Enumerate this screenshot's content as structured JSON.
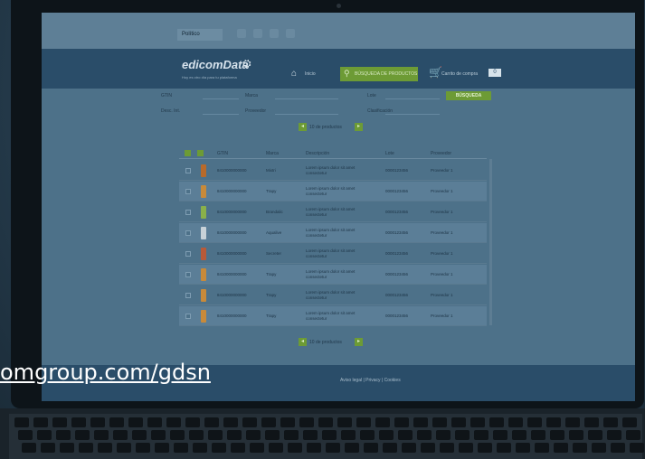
{
  "topbar": {
    "language": "Político"
  },
  "header": {
    "logo_text": "edicomData",
    "tagline": "Hoy es otro día para tu plataforma",
    "home_label": "Inicio",
    "search_tab_label": "BÚSQUEDA DE PRODUCTOS",
    "cart_label": "Carrito de compra",
    "cart_count": "0"
  },
  "filters": {
    "label_1": "GTIN",
    "value_1": "",
    "label_2": "Marca",
    "value_2": "",
    "label_3": "Lote",
    "value_3": "",
    "label_4": "Desc. Int.",
    "value_4": "",
    "label_5": "Proveedor",
    "value_5": "",
    "label_6": "Clasificación",
    "value_6": "",
    "search_button": "BÚSQUEDA"
  },
  "pager": {
    "text": "10   de productos"
  },
  "table": {
    "headers": [
      "GTIN",
      "Marca",
      "Descripción",
      "Lote",
      "Proveedor"
    ],
    "rows": [
      {
        "gtin": "8410000000000",
        "brand": "Mixtri",
        "desc": "Lorem ipsum dolor sit amet consectetur",
        "lot": "0000123456",
        "supplier": "Proveedor 1",
        "color": "#b86a2a"
      },
      {
        "gtin": "8410000000000",
        "brand": "Trapy",
        "desc": "Lorem ipsum dolor sit amet consectetur",
        "lot": "0000123456",
        "supplier": "Proveedor 1",
        "color": "#c88a3a"
      },
      {
        "gtin": "8410000000000",
        "brand": "Brandalic",
        "desc": "Lorem ipsum dolor sit amet consectetur",
        "lot": "0000123456",
        "supplier": "Proveedor 1",
        "color": "#8ab04a"
      },
      {
        "gtin": "8410000000000",
        "brand": "Aqualive",
        "desc": "Lorem ipsum dolor sit amet consectetur",
        "lot": "0000123456",
        "supplier": "Proveedor 1",
        "color": "#c8d2d8"
      },
      {
        "gtin": "8410000000000",
        "brand": "Secreter",
        "desc": "Lorem ipsum dolor sit amet consectetur",
        "lot": "0000123456",
        "supplier": "Proveedor 1",
        "color": "#b85a38"
      },
      {
        "gtin": "8410000000000",
        "brand": "Trapy",
        "desc": "Lorem ipsum dolor sit amet consectetur",
        "lot": "0000123456",
        "supplier": "Proveedor 1",
        "color": "#c88a3a"
      },
      {
        "gtin": "8410000000000",
        "brand": "Trapy",
        "desc": "Lorem ipsum dolor sit amet consectetur",
        "lot": "0000123456",
        "supplier": "Proveedor 1",
        "color": "#c88a3a"
      },
      {
        "gtin": "8410000000000",
        "brand": "Trapy",
        "desc": "Lorem ipsum dolor sit amet consectetur",
        "lot": "0000123456",
        "supplier": "Proveedor 1",
        "color": "#c88a3a"
      }
    ]
  },
  "footer": {
    "links": "Aviso legal  |  Privacy  |  Cookies"
  },
  "overlay": {
    "url": "omgroup.com/gdsn"
  },
  "colors": {
    "accent": "#6d9b35",
    "header": "#2a4d69",
    "screen": "#4d7189"
  }
}
